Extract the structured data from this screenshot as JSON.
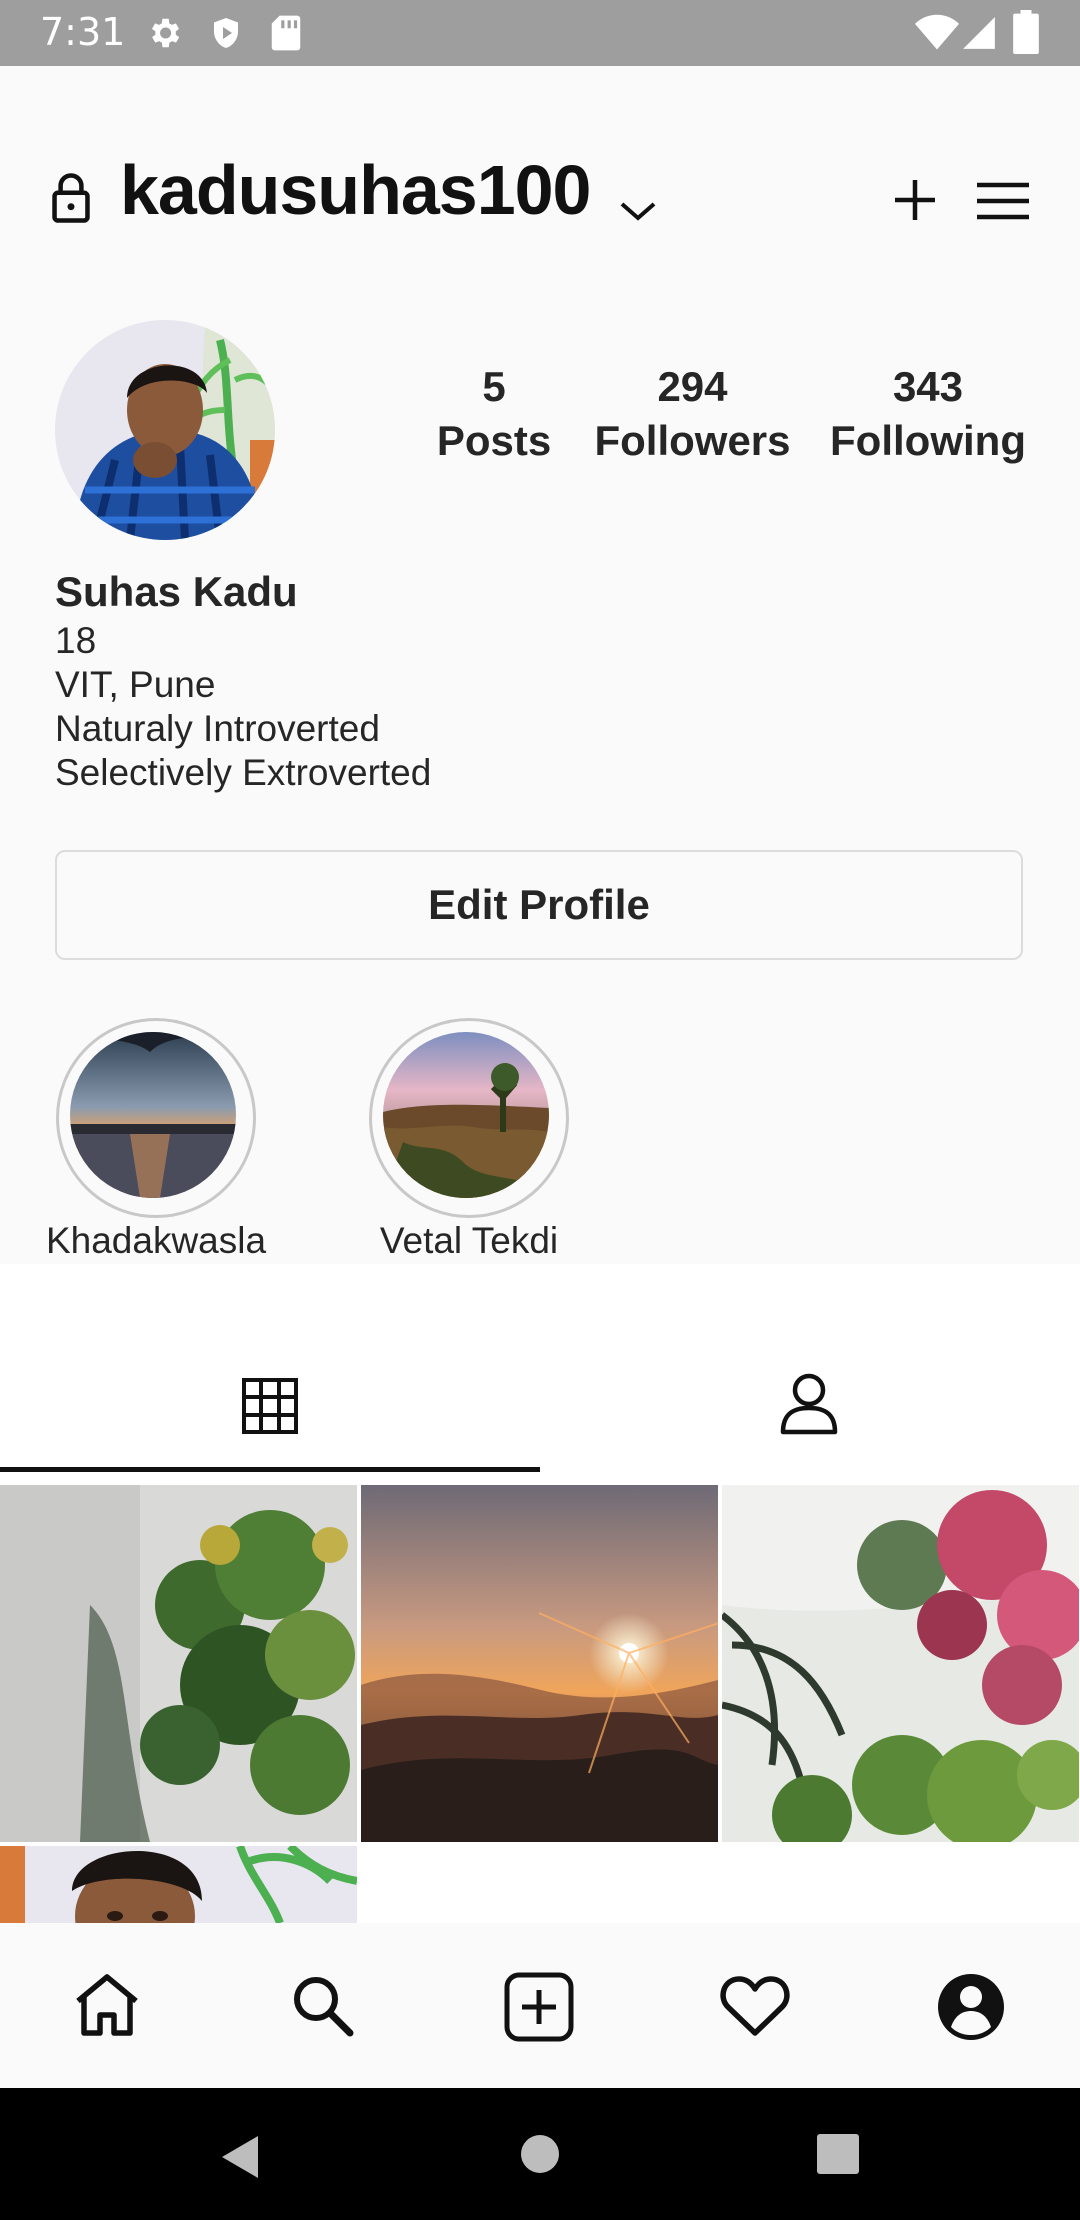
{
  "status_bar": {
    "time": "7:31"
  },
  "header": {
    "username": "kadusuhas100"
  },
  "stats": [
    {
      "value": "5",
      "label": "Posts"
    },
    {
      "value": "294",
      "label": "Followers"
    },
    {
      "value": "343",
      "label": "Following"
    }
  ],
  "bio": {
    "name": "Suhas Kadu",
    "lines": [
      "18",
      "VIT, Pune",
      "Naturaly Introverted",
      "Selectively Extroverted"
    ]
  },
  "edit_profile_label": "Edit Profile",
  "highlights": [
    {
      "label": "Khadakwasla"
    },
    {
      "label": "Vetal Tekdi"
    }
  ],
  "icons": {
    "status": [
      "settings-icon",
      "shield-icon",
      "sd-card-icon",
      "wifi-icon",
      "signal-icon",
      "battery-icon"
    ],
    "header": [
      "lock-icon",
      "chevron-down-icon",
      "plus-icon",
      "menu-icon"
    ],
    "tabs": [
      "grid-icon",
      "tagged-person-icon"
    ],
    "bottom_nav": [
      "home-icon",
      "search-icon",
      "new-post-icon",
      "heart-icon",
      "profile-icon"
    ],
    "system_nav": [
      "back-icon",
      "home-circle-icon",
      "recents-icon"
    ]
  }
}
